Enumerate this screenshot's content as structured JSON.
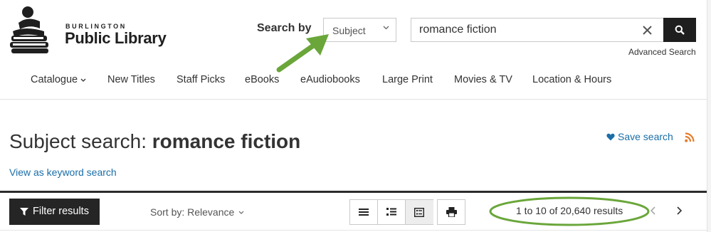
{
  "header": {
    "logo_top": "BURLINGTON",
    "logo_main": "Public Library",
    "search_by_label": "Search by",
    "search_by_selected": "Subject",
    "search_value": "romance fiction",
    "advanced_search": "Advanced Search"
  },
  "nav": {
    "items": [
      {
        "label": "Catalogue",
        "has_dropdown": true
      },
      {
        "label": "New Titles"
      },
      {
        "label": "Staff Picks"
      },
      {
        "label": "eBooks"
      },
      {
        "label": "eAudiobooks"
      },
      {
        "label": "Large Print"
      },
      {
        "label": "Movies & TV"
      },
      {
        "label": "Location & Hours"
      }
    ]
  },
  "main": {
    "title_prefix": "Subject search: ",
    "title_query": "romance fiction",
    "save_search": "Save search",
    "keyword_link": "View as keyword search",
    "filter_results": "Filter results",
    "sort_by": "Sort by: Relevance",
    "results_count": "1 to 10 of 20,640 results"
  },
  "icons": {
    "logo": "book-stack-reader-logo",
    "clear": "close-icon",
    "search": "search-icon",
    "heart": "heart-icon",
    "rss": "rss-icon",
    "filter": "filter-icon",
    "view_list": "list-view-icon",
    "view_summary": "summary-view-icon",
    "view_detail": "detail-view-icon",
    "print": "print-icon",
    "prev": "chevron-left-icon",
    "next": "chevron-right-icon"
  },
  "colors": {
    "link": "#1a6ea8",
    "annotation_green": "#6aa63a",
    "rss_orange": "#e57c2a",
    "dark_button": "#252525"
  }
}
